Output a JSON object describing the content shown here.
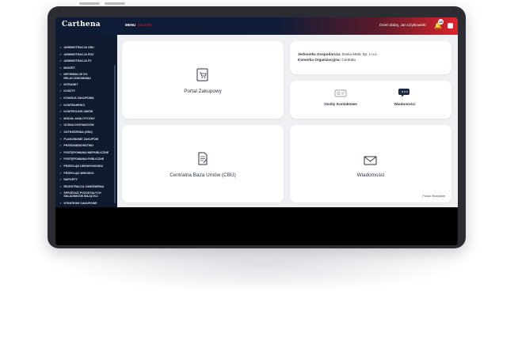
{
  "header": {
    "logo": "Carthena",
    "menu_label": "MENU",
    "menu_sub": "SKLEPS",
    "greeting": "Dzień dobry, Jan Użytkownik!",
    "notification_count": "18"
  },
  "sidebar": {
    "items": [
      {
        "label": "ADMINISTRACJA CBU"
      },
      {
        "label": "ADMINISTRACJA EOZ"
      },
      {
        "label": "ADMINISTRACJA PZ"
      },
      {
        "label": "BUDŻET"
      },
      {
        "label": "INFORMACJE DO RELACJONOWANIA"
      },
      {
        "label": "INTRANET"
      },
      {
        "label": "KOSZTY"
      },
      {
        "label": "KOMISJA ZAKUPOWA"
      },
      {
        "label": "KONTRAHENCI"
      },
      {
        "label": "KONTROLING UMÓW"
      },
      {
        "label": "MODUŁ ANALITYCZNY"
      },
      {
        "label": "OCENA DOSTAWCÓW"
      },
      {
        "label": "OSTRZEŻENIA (CBU)"
      },
      {
        "label": "PLANOWANIE ZAKUPÓW"
      },
      {
        "label": "PRZEDSIĘBIORSTWO"
      },
      {
        "label": "POSTĘPOWANIA NIEPUBLICZNE"
      },
      {
        "label": "POSTĘPOWANIA PUBLICZNE"
      },
      {
        "label": "PRZEGLĄD UMOWY/NIOSKU"
      },
      {
        "label": "PRZEGLĄD WNIOSKU"
      },
      {
        "label": "RAPORTY"
      },
      {
        "label": "REJESTRACJA ZAMÓWIENIA"
      },
      {
        "label": "SPRZEDAŻ POZOSTAŁYCH SKŁADNIKÓW MAJĄTKU"
      },
      {
        "label": "STRATEGIE ZAKUPOWE"
      }
    ]
  },
  "cards": {
    "portal": {
      "title": "Portal Zakupowy"
    },
    "info": {
      "unit_label": "Jednostka Gospodarcza:",
      "unit_value": "Dania Matic Sp. z o.o.",
      "org_label": "Komórka Organizacyjna:",
      "org_value": "Centrala"
    },
    "contacts": {
      "label": "Osoby Kontaktowe"
    },
    "messages_small": {
      "label": "Wiadomości"
    },
    "cbu": {
      "title": "Centralna Baza Umów (CBU)"
    },
    "messages": {
      "title": "Wiadomości",
      "see_all": "Pokaż Wszystkie"
    }
  },
  "colors": {
    "navy": "#0d1b34",
    "red": "#e0232c",
    "sidebar": "#0f1a2e",
    "panel_bg": "#eef0f3"
  }
}
